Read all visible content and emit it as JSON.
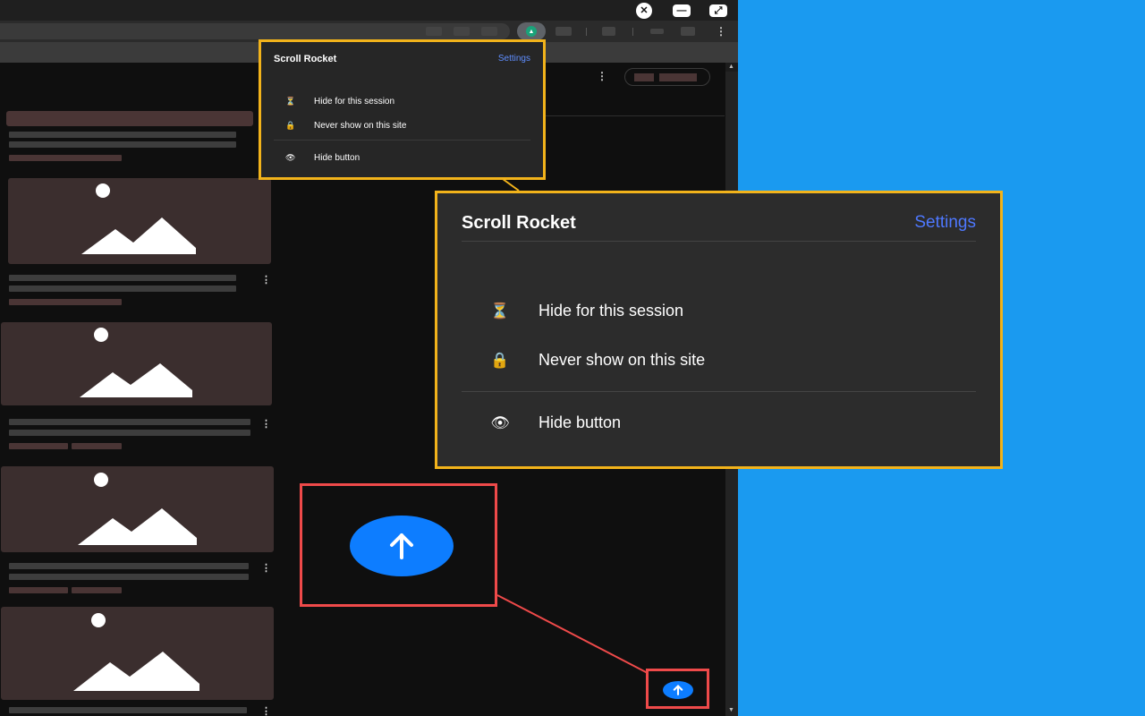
{
  "window_controls": {
    "close_glyph": "✕",
    "minimize_glyph": "—",
    "restore_glyph": "⤢"
  },
  "toolbar": {
    "extension_icon": "rocket-icon",
    "menu_glyph": "⋮"
  },
  "feed": {
    "more_glyph": "⋮"
  },
  "popup": {
    "title": "Scroll Rocket",
    "settings_label": "Settings",
    "items": [
      {
        "icon": "hourglass-icon",
        "glyph": "⏳",
        "label": "Hide for this session"
      },
      {
        "icon": "lock-icon",
        "glyph": "🔒",
        "label": "Never show on this site"
      },
      {
        "icon": "eye-icon",
        "glyph": "👁",
        "label": "Hide button"
      }
    ]
  },
  "scroll_button": {
    "icon": "arrow-up-icon",
    "color": "#0d7dff"
  },
  "colors": {
    "popup_border": "#f2b31b",
    "highlight_border": "#ef4a4a",
    "background": "#1a9af0",
    "settings_link": "#4e78ff"
  }
}
